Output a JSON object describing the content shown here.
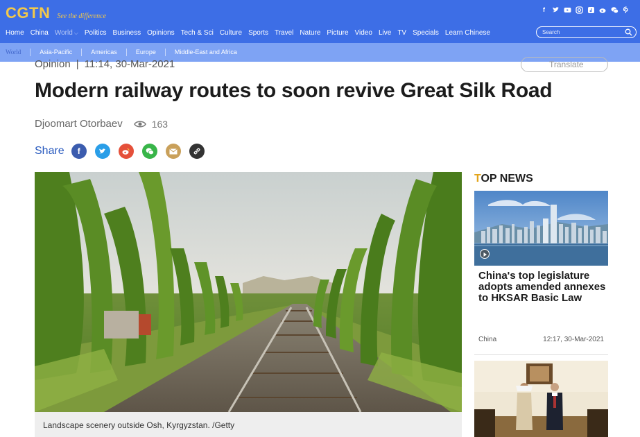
{
  "brand": {
    "logo": "CGTN",
    "slogan": "See the difference"
  },
  "social_icons": [
    "facebook-icon",
    "twitter-icon",
    "youtube-icon",
    "instagram-icon",
    "tiktok-icon",
    "weibo-icon",
    "wechat-icon",
    "pinterest-icon"
  ],
  "nav": {
    "items": [
      "Home",
      "China",
      "World",
      "Politics",
      "Business",
      "Opinions",
      "Tech & Sci",
      "Culture",
      "Sports",
      "Travel",
      "Nature",
      "Picture",
      "Video",
      "Live",
      "TV",
      "Specials",
      "Learn Chinese"
    ],
    "active": "World"
  },
  "search": {
    "placeholder": "Search"
  },
  "subnav": {
    "items": [
      "World",
      "Asia-Pacific",
      "Americas",
      "Europe",
      "Middle-East and Africa"
    ]
  },
  "article": {
    "category": "Opinion",
    "datetime": "11:14, 30-Mar-2021",
    "translate_label": "Translate",
    "title": "Modern railway routes to soon revive Great Silk Road",
    "author": "Djoomart Otorbaev",
    "views": "163",
    "share_label": "Share",
    "share_buttons": [
      "facebook-icon",
      "twitter-icon",
      "weibo-icon",
      "wechat-icon",
      "email-icon",
      "link-icon"
    ],
    "caption": "Landscape scenery outside Osh, Kyrgyzstan. /Getty"
  },
  "sidebar": {
    "heading_first": "T",
    "heading_rest": "OP NEWS",
    "story1": {
      "title": "China's top legislature adopts amended annexes to HKSAR Basic Law",
      "category": "China",
      "time": "12:17, 30-Mar-2021"
    }
  },
  "colors": {
    "topbar": "#3d6ee6",
    "subnav": "#7ea3f4",
    "logo": "#f2c84b",
    "share_text": "#2a5bbf"
  }
}
